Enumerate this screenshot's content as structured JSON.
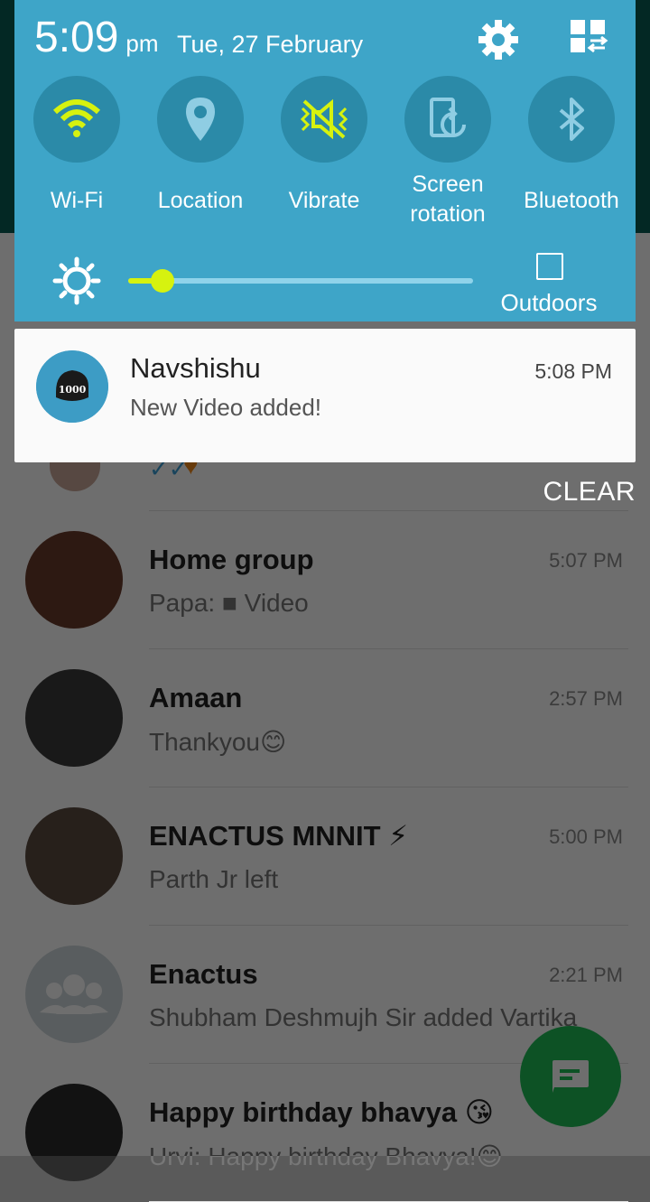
{
  "status": {
    "time": "5:09",
    "ampm": "pm",
    "date": "Tue, 27 February"
  },
  "quick_settings": [
    {
      "label": "Wi-Fi",
      "icon": "wifi-icon",
      "active": true
    },
    {
      "label": "Location",
      "icon": "location-icon",
      "active": false
    },
    {
      "label": "Vibrate",
      "icon": "vibrate-icon",
      "active": true
    },
    {
      "label": "Screen\nrotation",
      "icon": "screen-rotation-icon",
      "active": false
    },
    {
      "label": "Bluetooth",
      "icon": "bluetooth-icon",
      "active": false
    }
  ],
  "brightness": {
    "level": 0.1,
    "outdoors_label": "Outdoors",
    "outdoors_checked": false
  },
  "notification": {
    "app": "Navshishu",
    "time": "5:08 PM",
    "text": "New Video added!",
    "logo_text": "1000"
  },
  "clear_label": "CLEAR",
  "chats": [
    {
      "name": "Home group",
      "time": "5:07 PM",
      "message_prefix": "Papa:",
      "message": "Video",
      "avatar_color": "#6a3a2a"
    },
    {
      "name": "Amaan",
      "time": "2:57 PM",
      "message": "Thankyou",
      "emoji": "😊",
      "avatar_color": "#3a3a3a"
    },
    {
      "name": "ENACTUS MNNIT",
      "name_emoji": "⚡",
      "time": "5:00 PM",
      "message": "Parth Jr left",
      "avatar_color": "#5a4a40"
    },
    {
      "name": "Enactus",
      "time": "2:21 PM",
      "message": "Shubham Deshmujh Sir added Vartika",
      "avatar_color": "#cfd8dc"
    },
    {
      "name": "Happy birthday bhavya",
      "name_emoji": "😘",
      "time": "",
      "message": "Urvi: Happy birthday Bhavya!",
      "emoji": "😊",
      "avatar_color": "#2b2b2b"
    }
  ],
  "colors": {
    "shade_bg": "#3ea5c8",
    "circle_bg": "#2b8aa8",
    "active_accent": "#d6f20f",
    "fab": "#1ebe57"
  }
}
